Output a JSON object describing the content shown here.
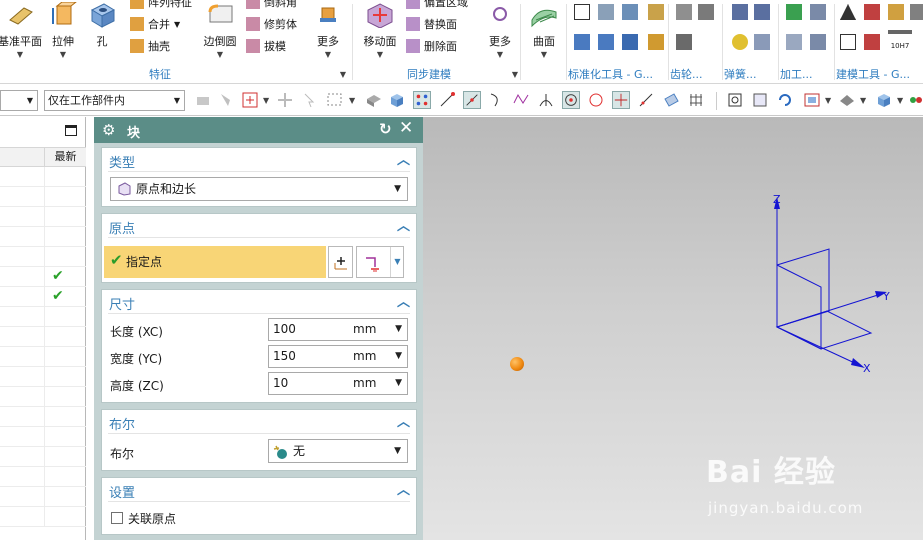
{
  "ribbon": {
    "feature_group": {
      "label": "特征",
      "datum_plane": "基准平面",
      "extrude": "拉伸",
      "hole": "孔",
      "pattern_feature": "阵列特征",
      "unite": "合并",
      "shell": "抽壳",
      "edge_blend": "边倒圆",
      "chamfer": "倒斜角",
      "trim_body": "修剪体",
      "draft": "拔模",
      "more": "更多"
    },
    "sync_group": {
      "label": "同步建模",
      "move_face": "移动面",
      "offset_region": "偏置区域",
      "replace_face": "替换面",
      "delete_face": "删除面",
      "more": "更多"
    },
    "surface_group": {
      "surface": "曲面"
    },
    "std_tools_label": "标准化工具 - G...",
    "gear_label": "齿轮...",
    "spring_label": "弹簧...",
    "machining_label": "加工...",
    "modeling_tools_label": "建模工具 - G...",
    "tolerance_icon_text": "10H7"
  },
  "toolbar2": {
    "filter_value": "",
    "scope_value": "仅在工作部件内"
  },
  "navigator": {
    "column_latest": "最新",
    "rows": [
      {
        "latest": false
      },
      {
        "latest": false
      },
      {
        "latest": false
      },
      {
        "latest": false
      },
      {
        "latest": false
      },
      {
        "latest": true
      },
      {
        "latest": true
      },
      {
        "latest": false
      },
      {
        "latest": false
      },
      {
        "latest": false
      },
      {
        "latest": false
      },
      {
        "latest": false
      },
      {
        "latest": false
      },
      {
        "latest": false
      },
      {
        "latest": false
      },
      {
        "latest": false
      },
      {
        "latest": false
      },
      {
        "latest": false
      }
    ],
    "check_glyph": "✔"
  },
  "dialog": {
    "title": "块",
    "type": {
      "title": "类型",
      "value": "原点和边长"
    },
    "origin": {
      "title": "原点",
      "specify_point": "指定点"
    },
    "dimensions": {
      "title": "尺寸",
      "length_label": "长度 (XC)",
      "length_value": "100",
      "length_unit": "mm",
      "width_label": "宽度 (YC)",
      "width_value": "150",
      "width_unit": "mm",
      "height_label": "高度 (ZC)",
      "height_value": "10",
      "height_unit": "mm"
    },
    "boolean": {
      "title": "布尔",
      "label": "布尔",
      "value": "无"
    },
    "settings": {
      "title": "设置",
      "associative_origin": "关联原点",
      "associative_checked": false
    }
  },
  "viewport": {
    "axis_x": "X",
    "axis_y": "Y",
    "axis_z": "Z",
    "watermark": "Bai 经验",
    "watermark_url": "jingyan.baidu.com"
  },
  "colors": {
    "dialog_title_bar": "#5b8d87",
    "section_title": "#3a7fb5",
    "selected_row": "#f8d576",
    "axis_triad": "#1414d2",
    "check_green": "#2aa12a"
  }
}
